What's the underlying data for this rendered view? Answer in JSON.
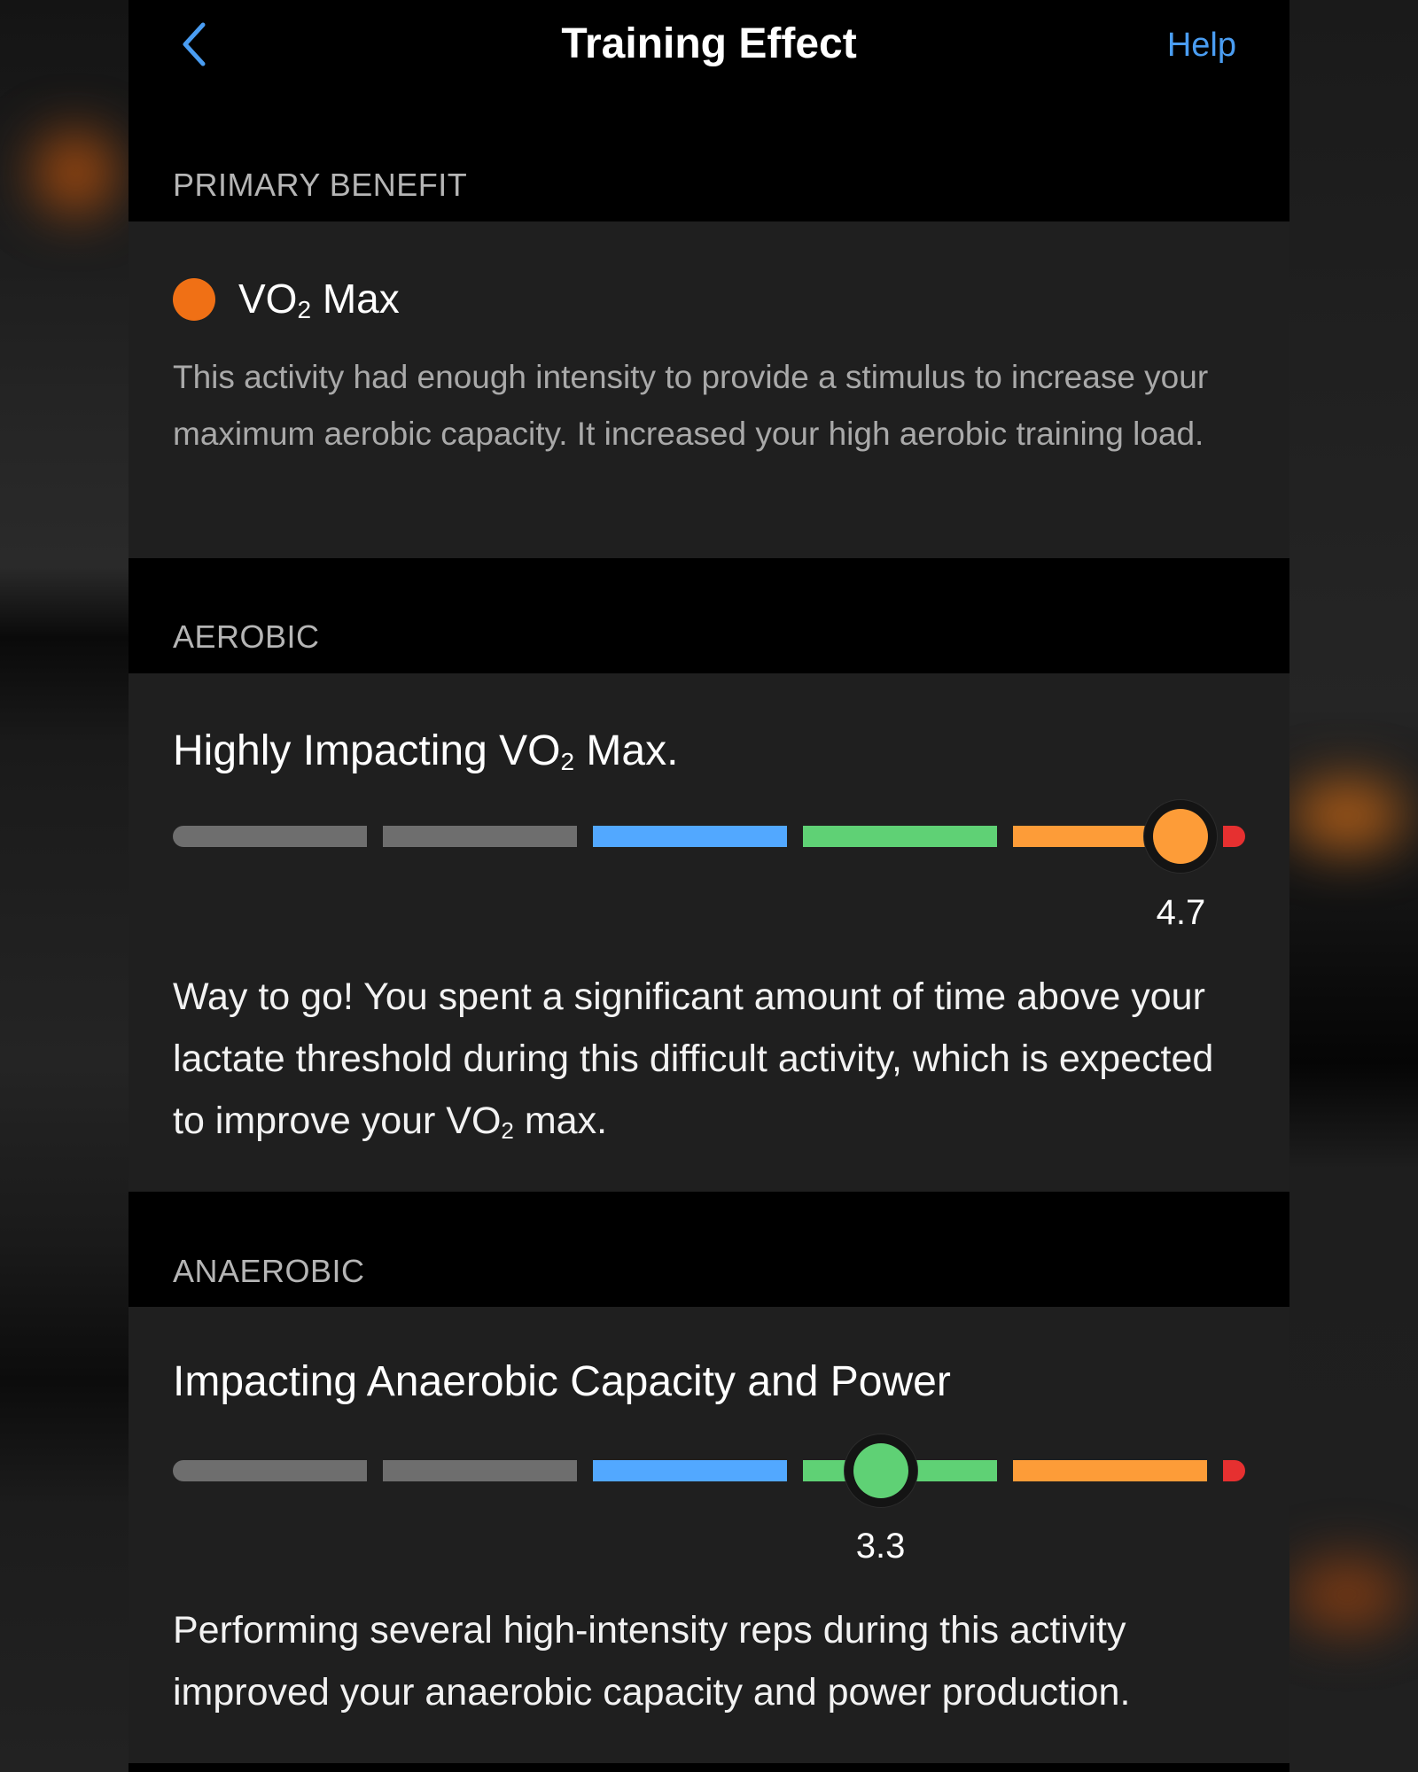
{
  "nav": {
    "back_icon": "chevron-left-icon",
    "title": "Training Effect",
    "help_label": "Help"
  },
  "colors": {
    "accent": "#4a9df2",
    "primary_dot": "#f07015",
    "gray": "#6e6e6e",
    "blue": "#52a8ff",
    "green": "#5fd175",
    "orange": "#fd9c38",
    "red": "#e63030"
  },
  "primary": {
    "label": "PRIMARY BENEFIT",
    "name_prefix": "VO",
    "name_sub": "2",
    "name_suffix": " Max",
    "description": "This activity had enough intensity to provide a stimulus to increase your maximum aerobic capacity. It increased your high aerobic training load."
  },
  "aerobic": {
    "label": "AEROBIC",
    "heading_prefix": "Highly Impacting VO",
    "heading_sub": "2",
    "heading_suffix": " Max.",
    "value": 4.7,
    "value_text": "4.7",
    "scale_max": 5,
    "knob_color": "orange",
    "description_prefix": "Way to go! You spent a significant amount of time above your lactate threshold during this difficult activity, which is expected to improve your VO",
    "description_sub": "2",
    "description_suffix": " max."
  },
  "anaerobic": {
    "label": "ANAEROBIC",
    "heading": "Impacting Anaerobic Capacity and Power",
    "value": 3.3,
    "value_text": "3.3",
    "scale_max": 5,
    "knob_color": "green",
    "description": "Performing several high-intensity reps during this activity improved your anaerobic capacity and power production."
  },
  "scale_segments": [
    "gray",
    "gray",
    "blue",
    "green",
    "orange",
    "red"
  ]
}
